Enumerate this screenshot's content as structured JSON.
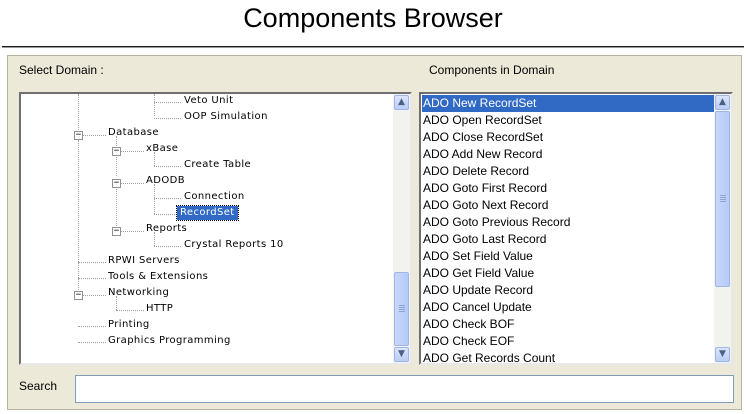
{
  "window": {
    "title": "Components Browser"
  },
  "domain_panel": {
    "label": "Select Domain :"
  },
  "components_panel": {
    "label": "Components in Domain"
  },
  "search": {
    "label": "Search",
    "value": "",
    "placeholder": ""
  },
  "colors": {
    "selection": "#316ac5",
    "panel_bg": "#ece9d8"
  },
  "tree": {
    "nodes": [
      {
        "label": "Veto Unit"
      },
      {
        "label": "OOP Simulation"
      },
      {
        "label": "Database",
        "expander": "minus"
      },
      {
        "label": "xBase",
        "expander": "minus"
      },
      {
        "label": "Create Table"
      },
      {
        "label": "ADODB",
        "expander": "minus"
      },
      {
        "label": "Connection"
      },
      {
        "label": "RecordSet",
        "selected": true
      },
      {
        "label": "Reports",
        "expander": "minus"
      },
      {
        "label": "Crystal Reports 10"
      },
      {
        "label": "RPWI Servers"
      },
      {
        "label": "Tools & Extensions"
      },
      {
        "label": "Networking",
        "expander": "minus"
      },
      {
        "label": "HTTP"
      },
      {
        "label": "Printing"
      },
      {
        "label": "Graphics Programming"
      }
    ]
  },
  "components": {
    "items": [
      "ADO New RecordSet",
      "ADO Open RecordSet",
      "ADO Close RecordSet",
      "ADO Add New Record",
      "ADO Delete Record",
      "ADO Goto First Record",
      "ADO Goto Next Record",
      "ADO Goto Previous Record",
      "ADO Goto Last Record",
      "ADO Set Field Value",
      "ADO Get Field Value",
      "ADO Update Record",
      "ADO Cancel Update",
      "ADO Check BOF",
      "ADO Check EOF",
      "ADO Get Records Count"
    ],
    "selected_index": 0
  },
  "icons": {
    "scroll_up": "▲",
    "scroll_down": "▼",
    "expander_minus": "−"
  }
}
